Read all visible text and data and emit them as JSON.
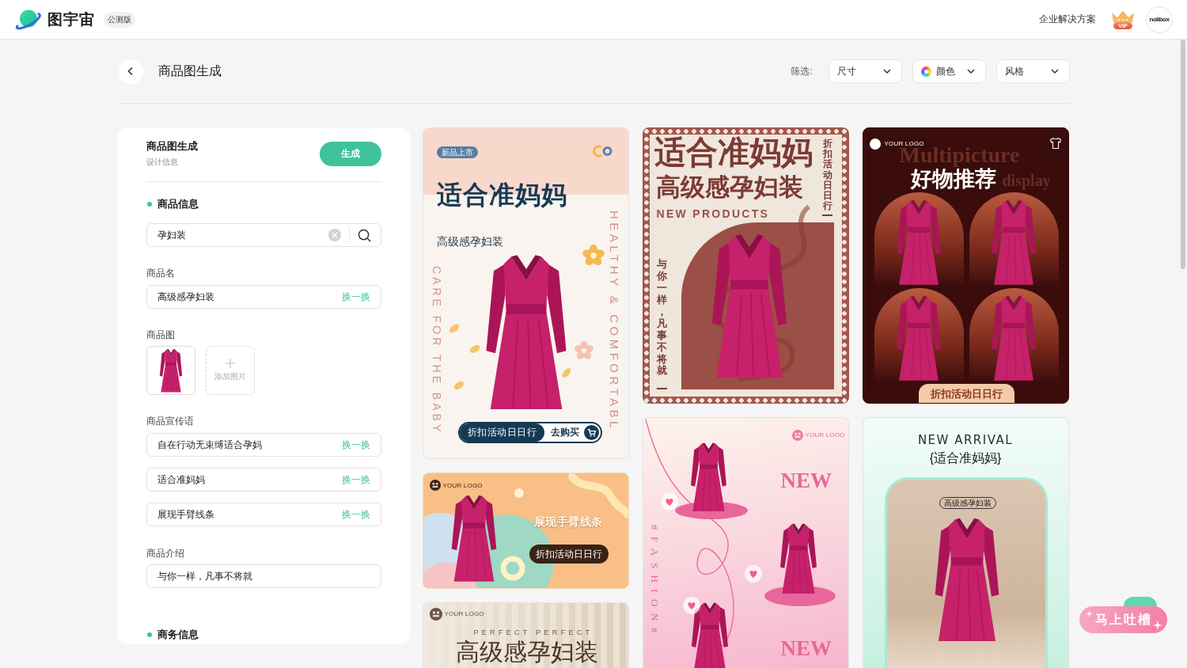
{
  "header": {
    "brand": "图宇宙",
    "badge": "公测版",
    "link": "企业解决方案",
    "vip": "VIP",
    "avatar": "nolibox"
  },
  "toolbar": {
    "title": "商品图生成",
    "filter_label": "筛选:",
    "filters": [
      {
        "label": "尺寸",
        "kind": "plain"
      },
      {
        "label": "颜色",
        "kind": "color"
      },
      {
        "label": "风格",
        "kind": "plain"
      }
    ]
  },
  "form": {
    "title": "商品图生成",
    "subtitle": "设计信息",
    "generate_button": "生成",
    "product_section": {
      "heading": "商品信息",
      "search": {
        "value": "孕妇装"
      },
      "name": {
        "label": "商品名",
        "value": "高级感孕妇装",
        "action": "换一换"
      },
      "images": {
        "label": "商品图",
        "add_label": "添加图片"
      },
      "slogans": {
        "label": "商品宣传语",
        "items": [
          {
            "value": "自在行动无束缚适合孕妈",
            "action": "换一换"
          },
          {
            "value": "适合准妈妈",
            "action": "换一换"
          },
          {
            "value": "展现手臂线条",
            "action": "换一换"
          }
        ]
      },
      "intro": {
        "label": "商品介绍",
        "value": "与你一样，凡事不将就"
      }
    },
    "business_section": {
      "heading": "商务信息"
    }
  },
  "results": {
    "columns": [
      [
        {
          "kind": "soft",
          "badge": "新品上市",
          "title": "适合准妈妈",
          "subtitle": "高级感孕妇装",
          "side_left": "CARE FOR THE BABY",
          "side_right": "HEALTHY & COMFORTABL",
          "promo": "折扣活动日日行",
          "buy": "去购买"
        },
        {
          "kind": "orange",
          "logo": "YOUR LOGO",
          "title": "展现手臂线条",
          "promo": "折扣活动日日行"
        },
        {
          "kind": "stripes",
          "logo": "YOUR LOGO",
          "tagline": "PERFECT PERFECT",
          "title": "高级感孕妇装"
        }
      ],
      [
        {
          "kind": "stamp",
          "title": "适合准妈妈",
          "subtitle": "高级感孕妇装",
          "tagline": "NEW PRODUCTS",
          "side_right": "折扣活动日日行",
          "side_left": "与你一样，凡事不将就"
        },
        {
          "kind": "pink",
          "logo": "YOUR LOGO",
          "words": [
            "NEW",
            "NEW"
          ],
          "side": "#FASHION#"
        }
      ],
      [
        {
          "kind": "arches",
          "logo": "YOUR LOGO",
          "backdrop": [
            "Multipicture",
            "display"
          ],
          "title": "好物推荐",
          "promo": "折扣活动日日行"
        },
        {
          "kind": "mint",
          "tagline": "NEW ARRIVAL",
          "title": "{适合准妈妈}",
          "tag": "高级感孕妇装"
        }
      ]
    ]
  },
  "feedback_button": "马上吐槽"
}
